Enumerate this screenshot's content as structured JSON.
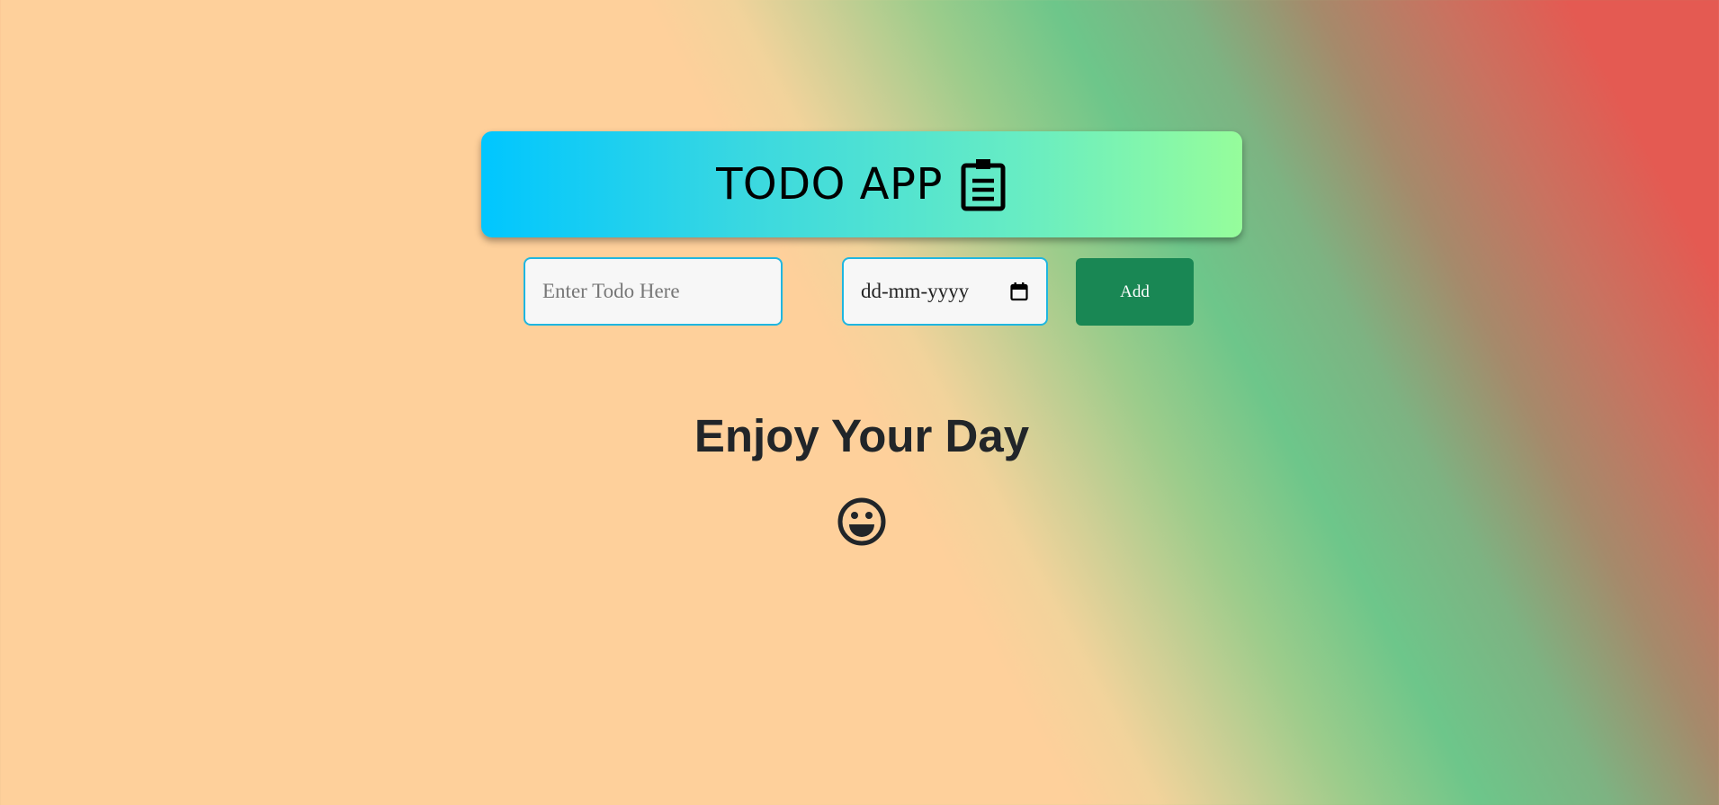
{
  "header": {
    "title": "TODO APP",
    "icon": "clipboard-icon",
    "gradient_start": "#00c6ff",
    "gradient_end": "#96fd9b"
  },
  "form": {
    "todo_placeholder": "Enter Todo Here",
    "todo_value": "",
    "date_value": "dd-mm-yyyy",
    "date_icon": "calendar-icon",
    "add_label": "Add",
    "add_color": "#198754",
    "input_border_color": "#1fb6e0"
  },
  "empty_state": {
    "message": "Enjoy Your Day",
    "icon": "smiley-icon"
  },
  "colors": {
    "background_left": "#fed09b",
    "background_mid": "#6dc68a",
    "background_right": "#e45a52",
    "text_dark": "#212529"
  }
}
